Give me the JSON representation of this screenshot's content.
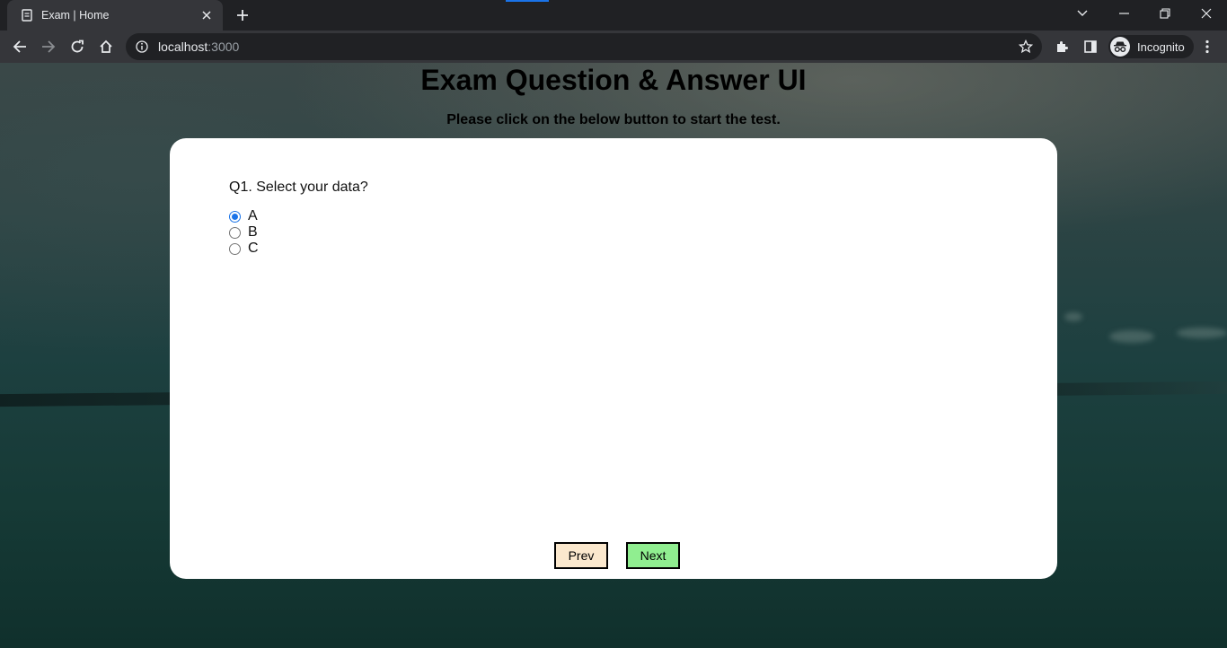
{
  "browser": {
    "tab_title": "Exam | Home",
    "url_host": "localhost",
    "url_port": ":3000",
    "profile_label": "Incognito",
    "accent_color": "#1a73e8"
  },
  "page": {
    "title": "Exam Question & Answer UI",
    "subtitle": "Please click on the below button to start the test."
  },
  "quiz": {
    "question": "Q1. Select your data?",
    "options": [
      {
        "label": "A",
        "selected": true
      },
      {
        "label": "B",
        "selected": false
      },
      {
        "label": "C",
        "selected": false
      }
    ],
    "prev_label": "Prev",
    "next_label": "Next",
    "prev_color": "#fbe8cd",
    "next_color": "#90ee90"
  },
  "icons": [
    "page-icon",
    "close-icon",
    "plus-icon",
    "chevron-down-icon",
    "minimize-icon",
    "restore-icon",
    "window-close-icon",
    "back-icon",
    "forward-icon",
    "reload-icon",
    "home-icon",
    "info-icon",
    "star-icon",
    "extensions-icon",
    "side-panel-icon",
    "incognito-icon",
    "kebab-menu-icon"
  ]
}
